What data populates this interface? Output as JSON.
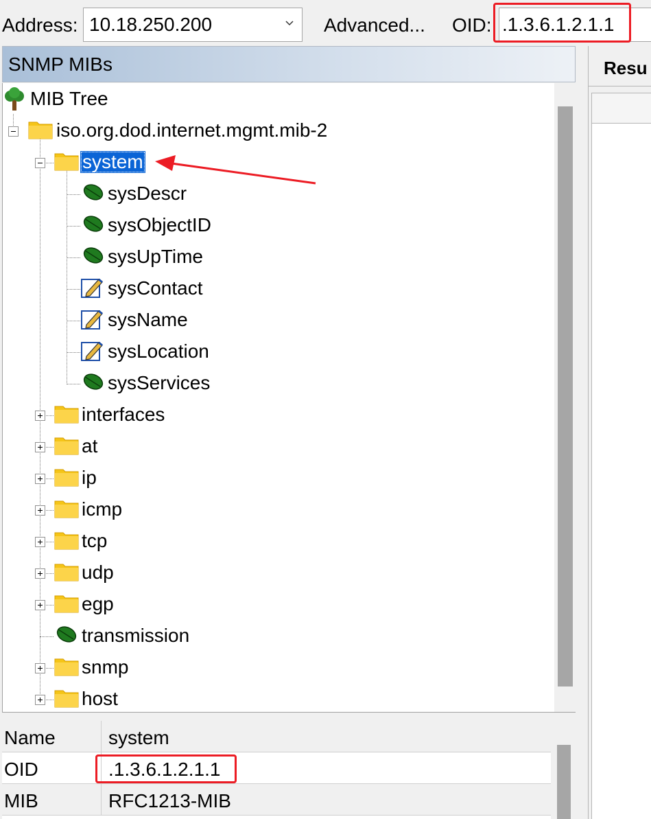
{
  "toolbar": {
    "address_label": "Address:",
    "address_value": "10.18.250.200",
    "advanced_label": "Advanced...",
    "oid_label": "OID:",
    "oid_value": ".1.3.6.1.2.1.1"
  },
  "left_panel": {
    "title": "SNMP MIBs",
    "tree": {
      "root": "MIB Tree",
      "mib2": "iso.org.dod.internet.mgmt.mib-2",
      "system": {
        "label": "system",
        "selected": true,
        "children": [
          {
            "label": "sysDescr",
            "icon": "leaf-icon"
          },
          {
            "label": "sysObjectID",
            "icon": "leaf-icon"
          },
          {
            "label": "sysUpTime",
            "icon": "leaf-icon"
          },
          {
            "label": "sysContact",
            "icon": "writable-leaf-icon"
          },
          {
            "label": "sysName",
            "icon": "writable-leaf-icon"
          },
          {
            "label": "sysLocation",
            "icon": "writable-leaf-icon"
          },
          {
            "label": "sysServices",
            "icon": "leaf-icon"
          }
        ]
      },
      "groups": [
        {
          "label": "interfaces",
          "icon": "folder-icon"
        },
        {
          "label": "at",
          "icon": "folder-icon"
        },
        {
          "label": "ip",
          "icon": "folder-icon"
        },
        {
          "label": "icmp",
          "icon": "folder-icon"
        },
        {
          "label": "tcp",
          "icon": "folder-icon"
        },
        {
          "label": "udp",
          "icon": "folder-icon"
        },
        {
          "label": "egp",
          "icon": "folder-icon"
        },
        {
          "label": "transmission",
          "icon": "leaf-icon"
        },
        {
          "label": "snmp",
          "icon": "folder-icon"
        },
        {
          "label": "host",
          "icon": "folder-icon"
        }
      ]
    }
  },
  "properties": [
    {
      "key": "Name",
      "value": "system"
    },
    {
      "key": "OID",
      "value": ".1.3.6.1.2.1.1"
    },
    {
      "key": "MIB",
      "value": "RFC1213-MIB"
    }
  ],
  "right_panel": {
    "tab_label": "Resu"
  },
  "colors": {
    "highlight": "#ec1c24",
    "selection": "#0a64d6",
    "folder": "#f5c518",
    "leaf": "#1f7a1f"
  }
}
